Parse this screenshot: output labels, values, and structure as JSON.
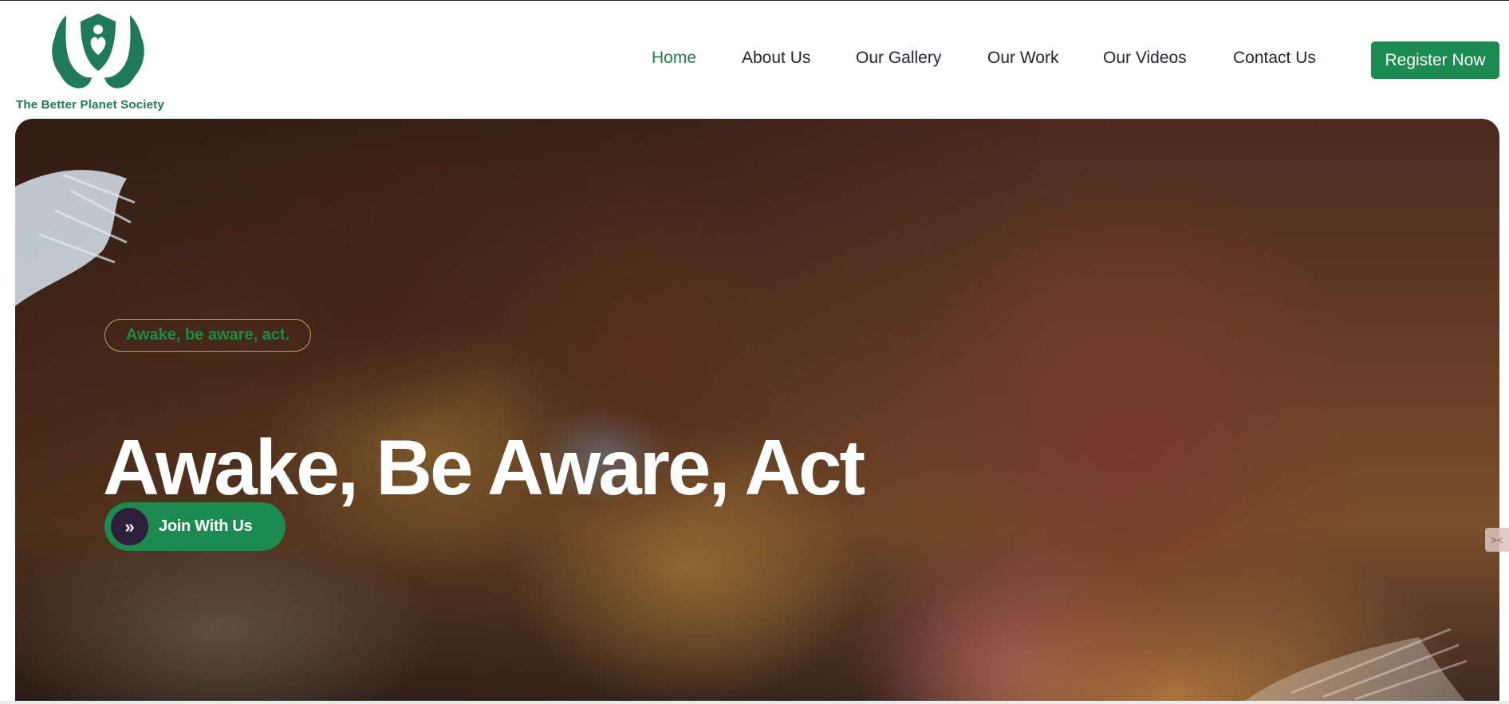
{
  "logo": {
    "text": "The Better Planet Society",
    "icon": "hands-heart-shield-icon",
    "color": "#1e7a55"
  },
  "nav": {
    "items": [
      {
        "label": "Home",
        "active": true
      },
      {
        "label": "About Us",
        "active": false
      },
      {
        "label": "Our Gallery",
        "active": false
      },
      {
        "label": "Our Work",
        "active": false
      },
      {
        "label": "Our Videos",
        "active": false
      },
      {
        "label": "Contact Us",
        "active": false
      }
    ],
    "register_label": "Register Now"
  },
  "hero": {
    "tagline": "Awake, be aware, act.",
    "headline": "Awake, Be Aware, Act",
    "cta_label": "Join With Us",
    "cta_icon": "double-chevron-right-icon"
  },
  "colors": {
    "brand_green": "#1d8a4f",
    "dark_purple": "#2d1e3e",
    "nav_text": "#2a2233",
    "active_nav": "#1e7e45"
  }
}
